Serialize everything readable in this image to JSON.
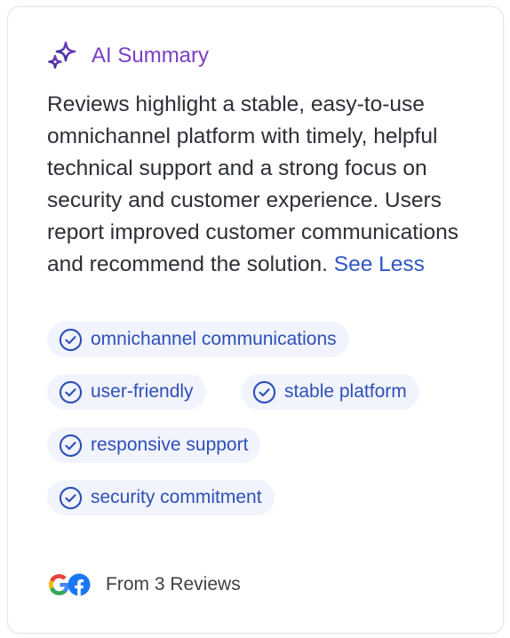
{
  "header": {
    "icon": "sparkle-icon",
    "title": "AI Summary",
    "accent_color": "#7b3fc6"
  },
  "summary": {
    "text": "Reviews highlight a stable, easy-to-use omnichannel platform with timely, helpful technical support and a strong focus on security and customer experience. Users report improved customer communications and recommend the solution.",
    "toggle_label": "See Less"
  },
  "tags": [
    {
      "label": "omnichannel communications",
      "icon": "check-circle-icon"
    },
    {
      "label": "user-friendly",
      "icon": "check-circle-icon"
    },
    {
      "label": "stable platform",
      "icon": "check-circle-icon"
    },
    {
      "label": "responsive support",
      "icon": "check-circle-icon"
    },
    {
      "label": "security commitment",
      "icon": "check-circle-icon"
    }
  ],
  "footer": {
    "sources": [
      "google-logo-icon",
      "facebook-logo-icon"
    ],
    "text": "From 3 Reviews"
  }
}
